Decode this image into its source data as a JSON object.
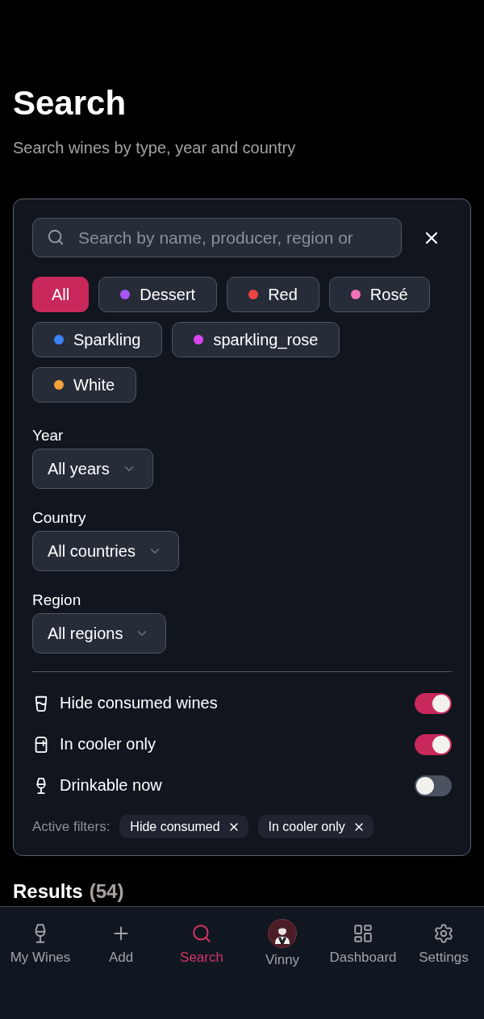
{
  "header": {
    "title": "Search",
    "subtitle": "Search wines by type, year and country"
  },
  "filters": {
    "search": {
      "placeholder": "Search by name, producer, region or"
    },
    "types": [
      {
        "label": "All",
        "selected": true
      },
      {
        "label": "Dessert",
        "selected": false,
        "color": "#a855f7"
      },
      {
        "label": "Red",
        "selected": false,
        "color": "#ef4444"
      },
      {
        "label": "Rosé",
        "selected": false,
        "color": "#f472b6"
      },
      {
        "label": "Sparkling",
        "selected": false,
        "color": "#3b82f6"
      },
      {
        "label": "sparkling_rose",
        "selected": false,
        "color": "#d946ef"
      },
      {
        "label": "White",
        "selected": false,
        "color": "#f2a33a"
      }
    ],
    "dropdowns": [
      {
        "label": "Year",
        "value": "All years"
      },
      {
        "label": "Country",
        "value": "All countries"
      },
      {
        "label": "Region",
        "value": "All regions"
      }
    ],
    "toggles": [
      {
        "label": "Hide consumed wines",
        "on": true
      },
      {
        "label": "In cooler only",
        "on": true
      },
      {
        "label": "Drinkable now",
        "on": false
      }
    ],
    "active_filters": {
      "label": "Active filters:",
      "chips": [
        "Hide consumed",
        "In cooler only"
      ]
    }
  },
  "results": {
    "title": "Results",
    "count": "(54)"
  },
  "nav": [
    {
      "label": "My Wines",
      "kind": "icon",
      "selected": false
    },
    {
      "label": "Add",
      "kind": "icon",
      "selected": false
    },
    {
      "label": "Search",
      "kind": "icon",
      "selected": true
    },
    {
      "label": "Vinny",
      "kind": "avatar",
      "selected": false
    },
    {
      "label": "Dashboard",
      "kind": "icon",
      "selected": false
    },
    {
      "label": "Settings",
      "kind": "icon",
      "selected": false
    }
  ]
}
